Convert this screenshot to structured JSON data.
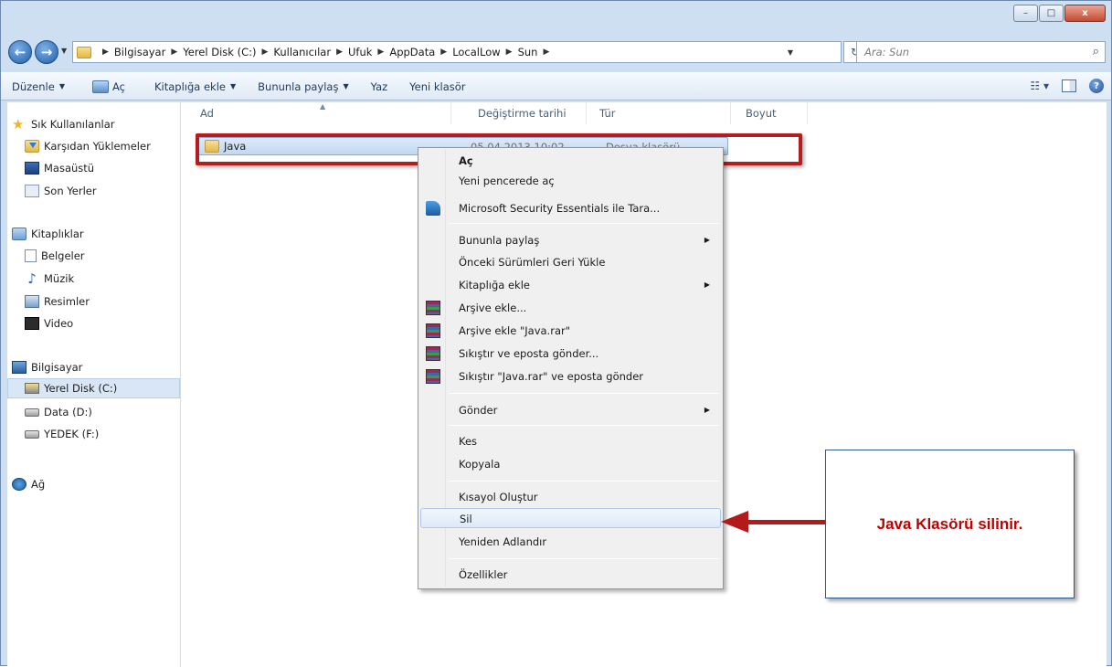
{
  "window": {
    "minimize": "–",
    "maximize": "□",
    "close": "x"
  },
  "nav": {
    "back": "←",
    "forward": "→",
    "breadcrumb": [
      "Bilgisayar",
      "Yerel Disk (C:)",
      "Kullanıcılar",
      "Ufuk",
      "AppData",
      "LocalLow",
      "Sun"
    ],
    "search_placeholder": "Ara: Sun"
  },
  "toolbar": {
    "organize": "Düzenle",
    "open": "Aç",
    "add_to_library": "Kitaplığa ekle",
    "share_with": "Bununla paylaş",
    "burn": "Yaz",
    "new_folder": "Yeni klasör"
  },
  "sidebar": {
    "favorites": "Sık Kullanılanlar",
    "downloads": "Karşıdan Yüklemeler",
    "desktop": "Masaüstü",
    "recent": "Son Yerler",
    "libraries": "Kitaplıklar",
    "documents": "Belgeler",
    "music": "Müzik",
    "pictures": "Resimler",
    "videos": "Video",
    "computer": "Bilgisayar",
    "local_disk": "Yerel Disk (C:)",
    "data_drive": "Data (D:)",
    "backup_drive": "YEDEK (F:)",
    "network": "Ağ"
  },
  "columns": {
    "name": "Ad",
    "modified": "Değiştirme tarihi",
    "type": "Tür",
    "size": "Boyut"
  },
  "files": [
    {
      "name": "Java",
      "modified": "05.04.2013 10:02",
      "type": "Dosya klasörü"
    }
  ],
  "context_menu": {
    "open": "Aç",
    "open_new_window": "Yeni pencerede aç",
    "scan_mse": "Microsoft Security Essentials ile Tara...",
    "share_with": "Bununla paylaş",
    "restore_previous": "Önceki Sürümleri Geri Yükle",
    "add_to_library": "Kitaplığa ekle",
    "add_to_archive": "Arşive ekle...",
    "add_to_java_rar": "Arşive ekle \"Java.rar\"",
    "compress_email": "Sıkıştır ve eposta gönder...",
    "compress_java_email": "Sıkıştır \"Java.rar\" ve eposta gönder",
    "send_to": "Gönder",
    "cut": "Kes",
    "copy": "Kopyala",
    "create_shortcut": "Kısayol Oluştur",
    "delete": "Sil",
    "rename": "Yeniden Adlandır",
    "properties": "Özellikler"
  },
  "callout": {
    "text": "Java Klasörü silinir."
  }
}
